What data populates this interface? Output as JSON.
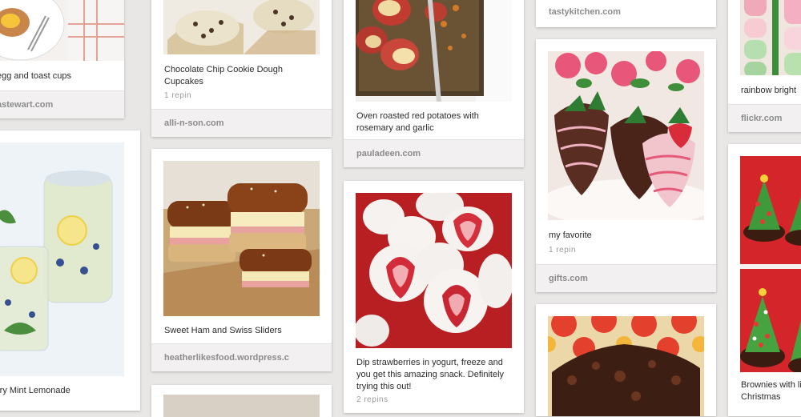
{
  "pins": [
    {
      "id": "p1",
      "description": "egg and toast cups",
      "source": "astewart.com",
      "repins": ""
    },
    {
      "id": "p2",
      "description": "Chocolate Chip Cookie Dough Cupcakes",
      "source": "alli-n-son.com",
      "repins": "1 repin"
    },
    {
      "id": "p3",
      "description": "Oven roasted red potatoes with rosemary and garlic",
      "source": "pauladeen.com",
      "repins": ""
    },
    {
      "id": "p4",
      "description": "",
      "source": "tastykitchen.com",
      "repins": ""
    },
    {
      "id": "p5",
      "description": "rainbow bright",
      "source": "flickr.com",
      "repins": ""
    },
    {
      "id": "p6",
      "description": "rry Mint Lemonade",
      "source": "",
      "repins": ""
    },
    {
      "id": "p7",
      "description": "Sweet Ham and Swiss Sliders",
      "source": "heatherlikesfood.wordpress.c",
      "repins": ""
    },
    {
      "id": "p8",
      "description": "Dip strawberries in yogurt, freeze and you get this amazing snack. Definitely trying this out!",
      "source": "",
      "repins": "2 repins"
    },
    {
      "id": "p9",
      "description": "my favorite",
      "source": "gifts.com",
      "repins": "1 repin"
    },
    {
      "id": "p10",
      "description": "",
      "source": "",
      "repins": ""
    },
    {
      "id": "p11",
      "description": "Brownies with little Christmas",
      "source": "",
      "repins": ""
    }
  ]
}
